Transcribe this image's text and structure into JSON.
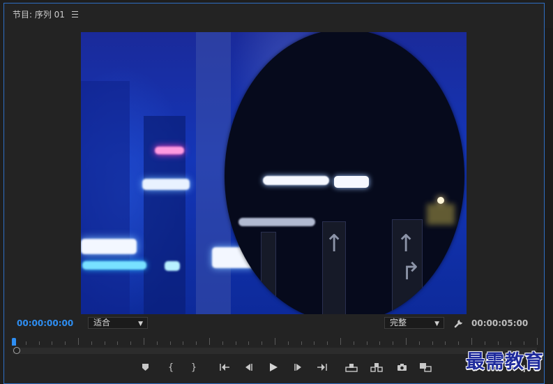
{
  "panel": {
    "title": "节目: 序列 01",
    "menu_icon": "hamburger-menu-icon"
  },
  "timecode": {
    "current": "00:00:00:00",
    "duration": "00:00:05:00"
  },
  "zoom_select": {
    "value": "适合",
    "icon": "chevron-down-icon"
  },
  "quality_select": {
    "value": "完整",
    "icon": "chevron-down-icon"
  },
  "settings": {
    "icon": "wrench-icon"
  },
  "playhead": {
    "position_fraction": 0.0
  },
  "transport": {
    "buttons": [
      {
        "name": "add-marker-button",
        "icon": "marker-icon",
        "glyph": "⬟"
      },
      {
        "name": "mark-in-button",
        "icon": "mark-in-icon",
        "glyph": "{"
      },
      {
        "name": "mark-out-button",
        "icon": "mark-out-icon",
        "glyph": "}"
      },
      {
        "name": "go-to-in-button",
        "icon": "go-to-in-icon",
        "glyph": "{⇤"
      },
      {
        "name": "step-back-button",
        "icon": "step-back-icon",
        "glyph": "◀|"
      },
      {
        "name": "play-button",
        "icon": "play-icon",
        "glyph": "▶"
      },
      {
        "name": "step-forward-button",
        "icon": "step-forward-icon",
        "glyph": "|▶"
      },
      {
        "name": "go-to-out-button",
        "icon": "go-to-out-icon",
        "glyph": "⇥}"
      },
      {
        "name": "lift-button",
        "icon": "lift-icon",
        "glyph": "⛶"
      },
      {
        "name": "extract-button",
        "icon": "extract-icon",
        "glyph": "⛶"
      },
      {
        "name": "export-frame-button",
        "icon": "camera-icon",
        "glyph": "📷"
      },
      {
        "name": "comparison-view-button",
        "icon": "comparison-view-icon",
        "glyph": "▣"
      }
    ],
    "add_button_glyph": "+"
  },
  "watermark": {
    "text": "最需教育"
  },
  "colors": {
    "accent": "#2e8ef2",
    "panel_border": "#2f6fc4",
    "watermark": "#1f2b9c"
  }
}
